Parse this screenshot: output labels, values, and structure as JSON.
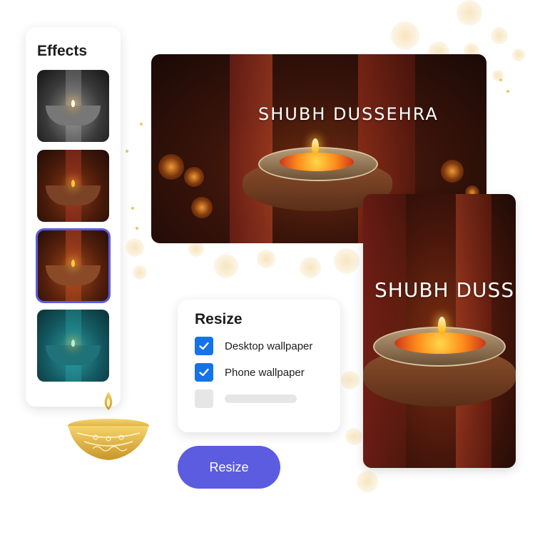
{
  "effects_panel": {
    "title": "Effects",
    "thumbnails": [
      {
        "name": "black-and-white"
      },
      {
        "name": "warm-original"
      },
      {
        "name": "vibrant",
        "selected": true
      },
      {
        "name": "teal-duotone"
      }
    ]
  },
  "desktop_preview": {
    "greeting": "SHUBH DUSSEHRA"
  },
  "phone_preview": {
    "greeting": "SHUBH DUSSEHRA"
  },
  "resize_card": {
    "title": "Resize",
    "options": [
      {
        "label": "Desktop wallpaper",
        "checked": true
      },
      {
        "label": "Phone wallpaper",
        "checked": true
      },
      {
        "label": "",
        "checked": false
      }
    ]
  },
  "resize_button": {
    "label": "Resize"
  },
  "colors": {
    "accent": "#5c5ce0",
    "checkbox": "#1473e6",
    "gold": "#e9c46a"
  },
  "icons": [
    "check-icon",
    "diya-icon"
  ]
}
